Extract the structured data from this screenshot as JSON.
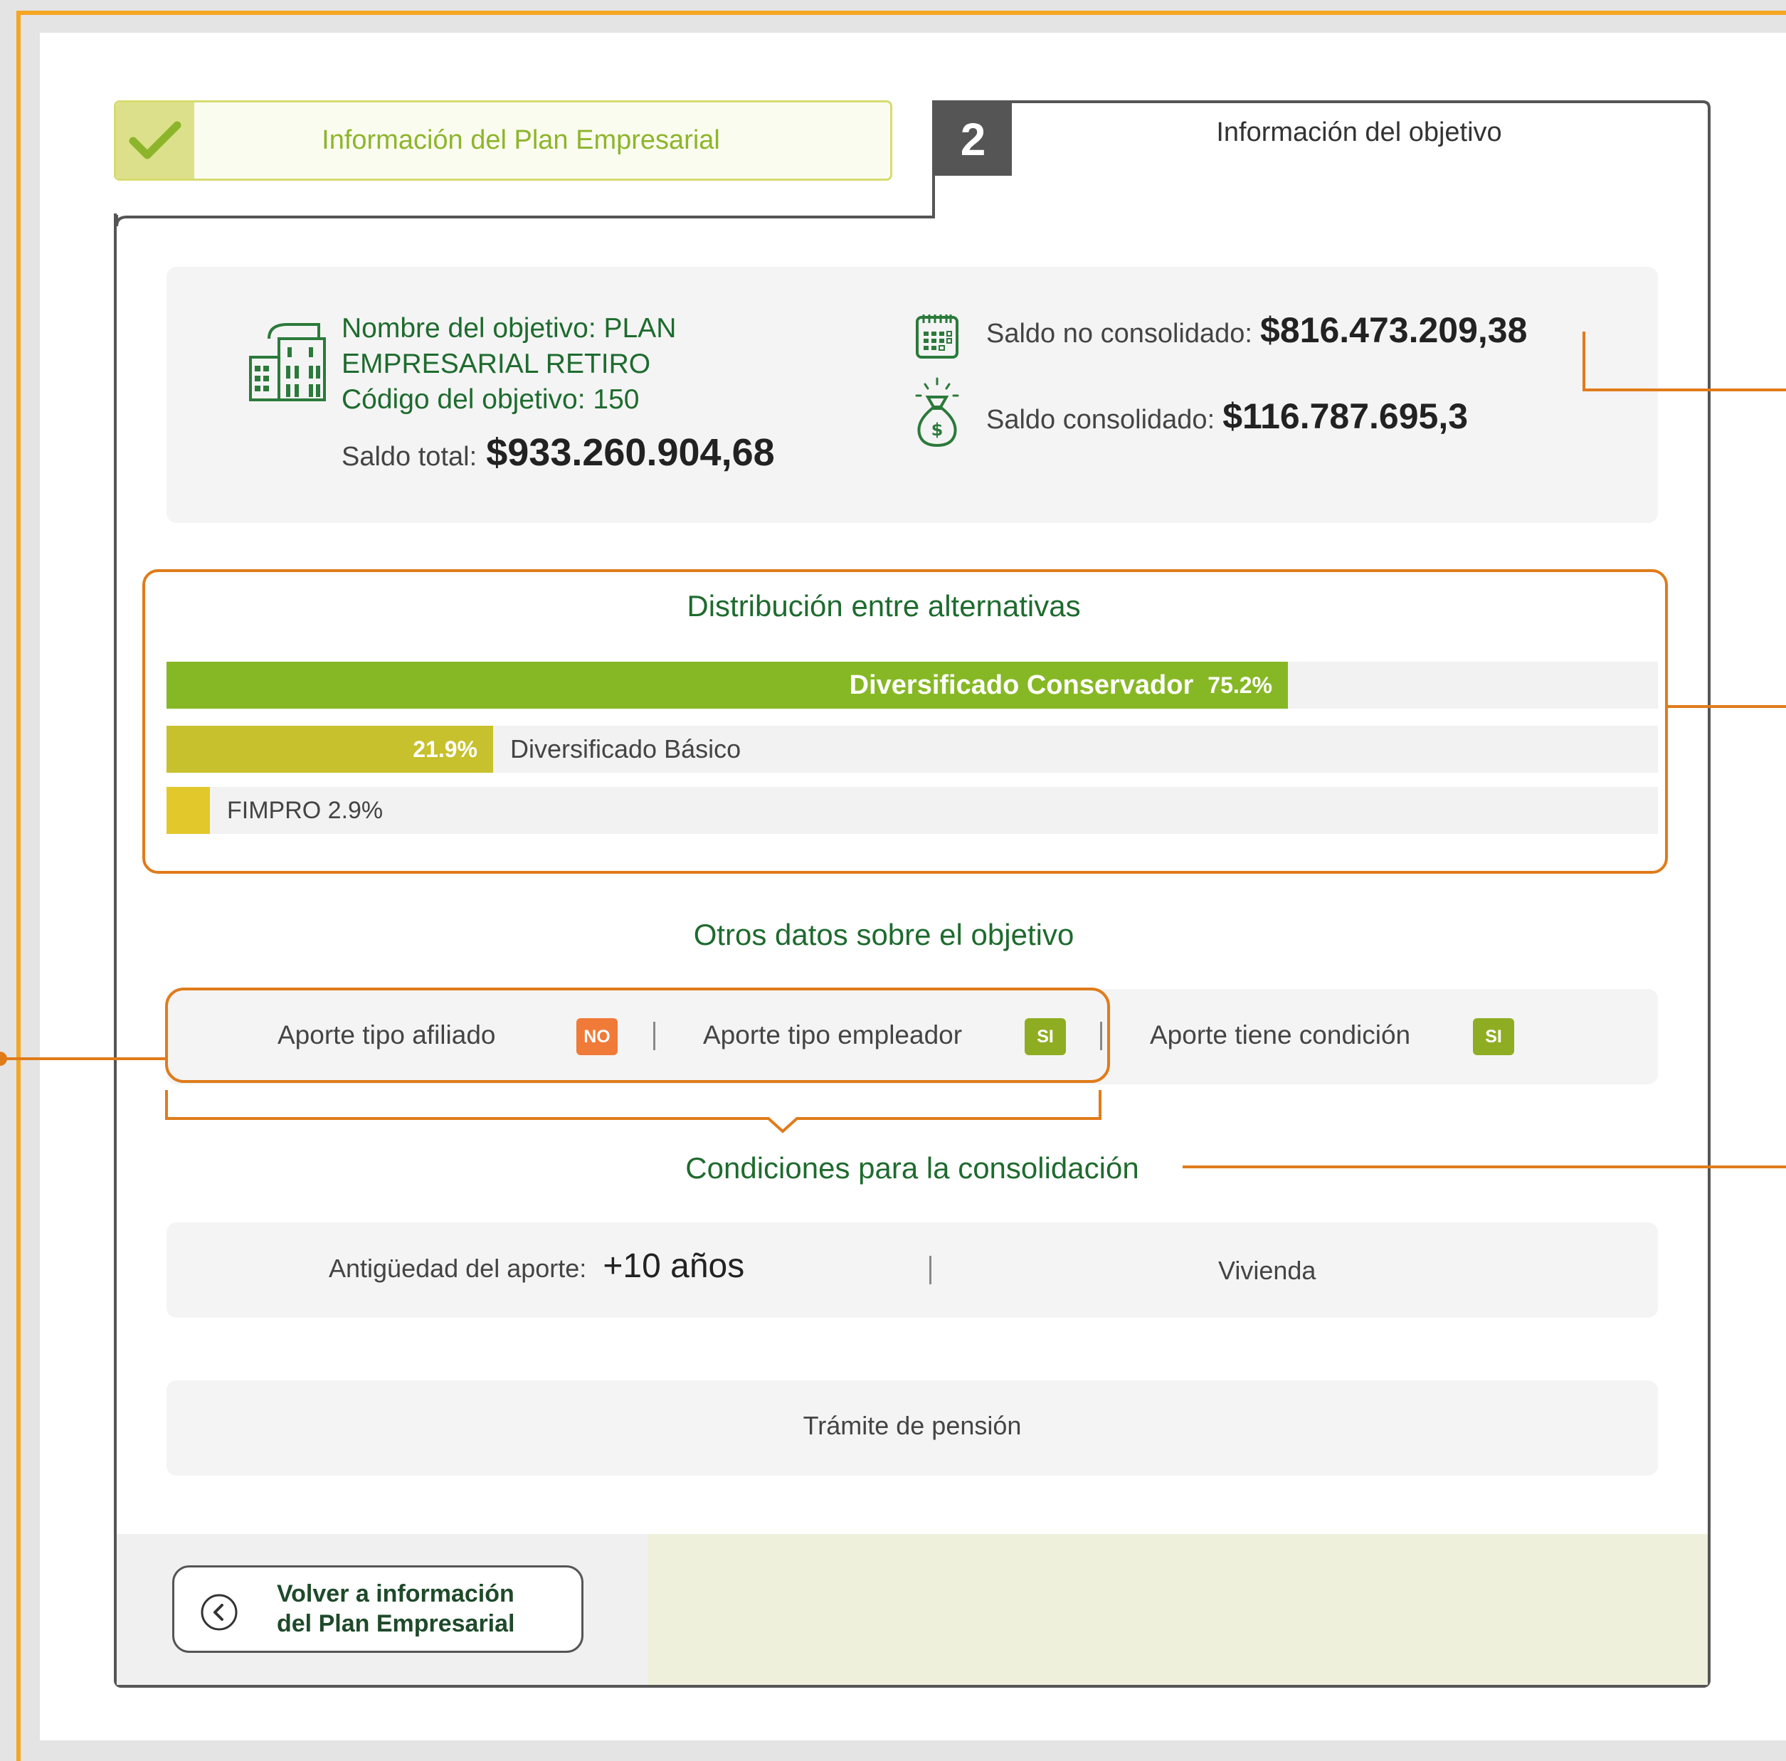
{
  "tabs": {
    "step1_label": "Información del Plan Empresarial",
    "step2_number": "2",
    "step2_label": "Información del objetivo"
  },
  "summary": {
    "name_label": "Nombre del objetivo: PLAN",
    "name_label_line2": "EMPRESARIAL RETIRO",
    "code_label": "Código del objetivo: 150",
    "total_label": "Saldo total:",
    "total_value": "$933.260.904,68",
    "no_consolidado_label": "Saldo no consolidado:",
    "no_consolidado_value": "$816.473.209,38",
    "consolidado_label": "Saldo consolidado:",
    "consolidado_value": "$116.787.695,3"
  },
  "distribution": {
    "title": "Distribución entre alternativas",
    "items": [
      {
        "label": "Diversificado Conservador",
        "percent_text": "75.2%",
        "percent": 75.2,
        "color": "#86b825"
      },
      {
        "label": "Diversificado Básico",
        "percent_text": "21.9%",
        "percent": 21.9,
        "color": "#c6c12c"
      },
      {
        "label": "FIMPRO",
        "percent_text": "2.9%",
        "percent": 2.9,
        "color": "#e2c82a"
      }
    ]
  },
  "otros": {
    "title": "Otros datos sobre el objetivo",
    "afiliado_label": "Aporte tipo afiliado",
    "afiliado_badge": "NO",
    "empleador_label": "Aporte tipo empleador",
    "empleador_badge": "SI",
    "condicion_label": "Aporte tiene condición",
    "condicion_badge": "SI"
  },
  "condiciones": {
    "title": "Condiciones para la consolidación",
    "antiguedad_label": "Antigüedad del aporte:",
    "antiguedad_value": "+10 años",
    "vivienda": "Vivienda",
    "pension": "Trámite de pensión"
  },
  "footer": {
    "back_line1": "Volver a información",
    "back_line2": "del Plan Empresarial"
  },
  "colors": {
    "accent_orange": "#e07b1a",
    "frame_orange": "#f5a623",
    "green_dark": "#1e6b2e",
    "badge_no": "#f07a38",
    "badge_si": "#8fad22"
  }
}
